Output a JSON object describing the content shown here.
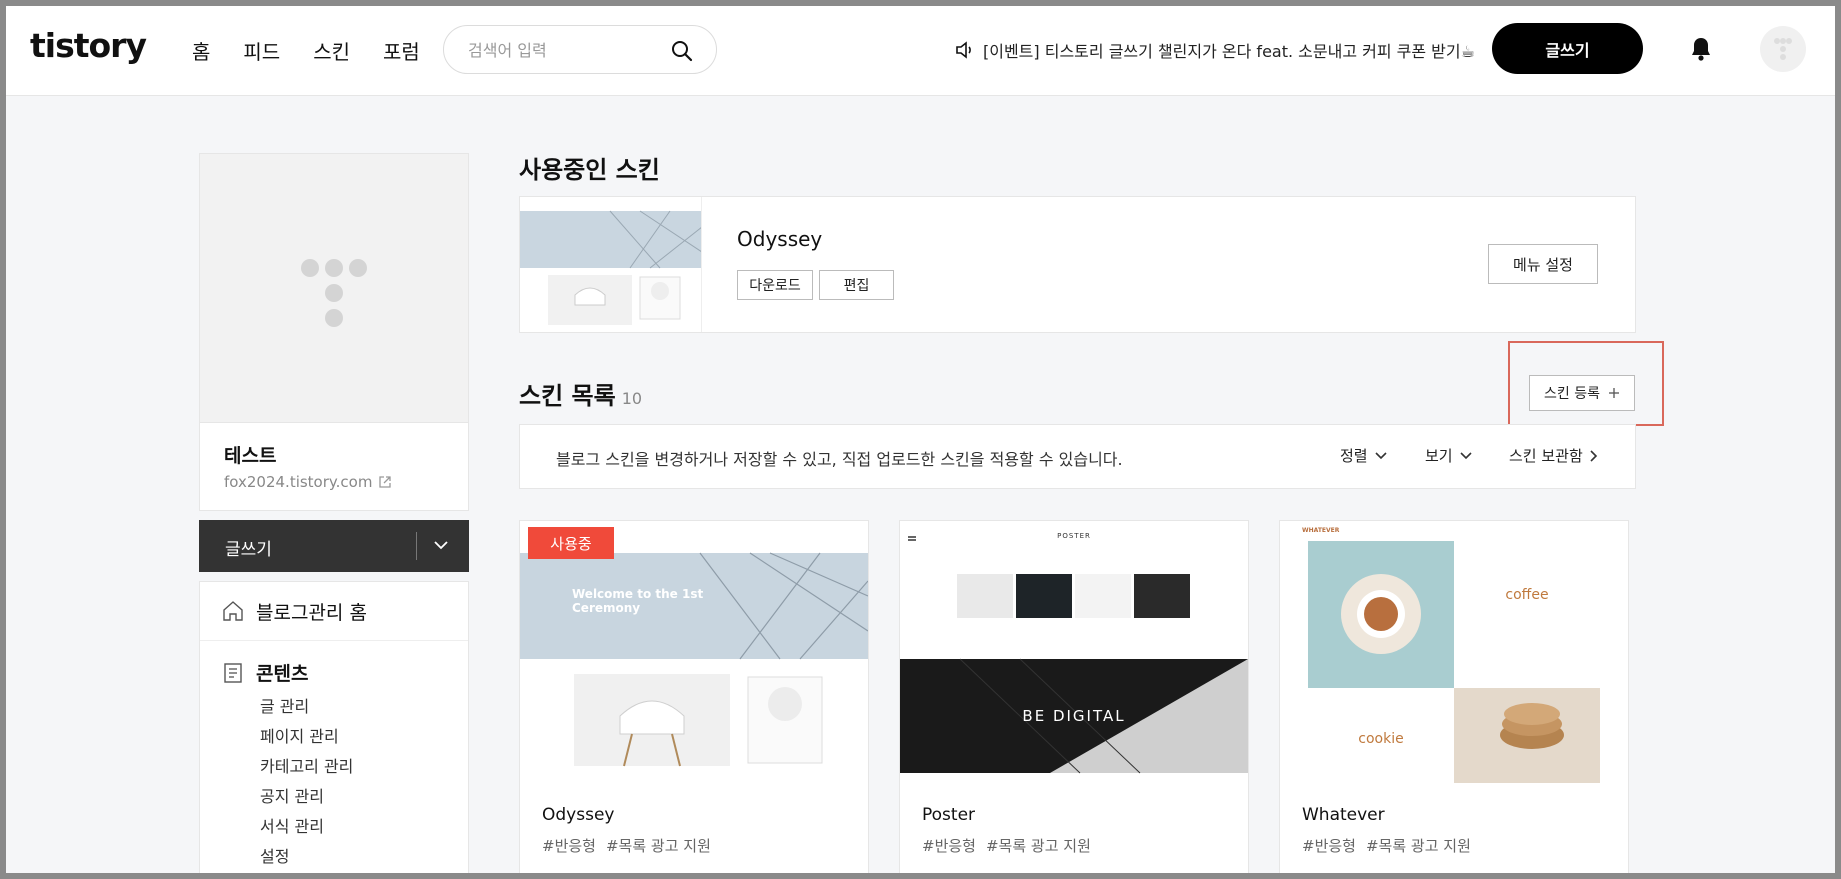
{
  "header": {
    "logo": "tistory",
    "nav": [
      "홈",
      "피드",
      "스킨",
      "포럼"
    ],
    "search_placeholder": "검색어 입력",
    "notice": "[이벤트] 티스토리 글쓰기 챌린지가 온다 feat. 소문내고 커피 쿠폰 받기☕",
    "write_button": "글쓰기"
  },
  "sidebar": {
    "blog_name": "테스트",
    "blog_url": "fox2024.tistory.com",
    "write_button": "글쓰기",
    "home_item": "블로그관리 홈",
    "section_title": "콘텐츠",
    "items": [
      "글 관리",
      "페이지 관리",
      "카테고리 관리",
      "공지 관리",
      "서식 관리",
      "설정"
    ]
  },
  "current_skin": {
    "heading": "사용중인 스킨",
    "name": "Odyssey",
    "download_label": "다운로드",
    "edit_label": "편집",
    "menu_settings_label": "메뉴 설정"
  },
  "skin_list": {
    "heading": "스킨 목록",
    "count": "10",
    "register_label": "스킨 등록",
    "info_text": "블로그 스킨을 변경하거나 저장할 수 있고, 직접 업로드한 스킨을 적용할 수 있습니다.",
    "sort_label": "정렬",
    "view_label": "보기",
    "storage_label": "스킨 보관함",
    "skins": [
      {
        "name": "Odyssey",
        "tags": [
          "#반응형",
          "#목록 광고 지원"
        ],
        "badge": "사용중",
        "preview_text": "Welcome to the 1st Ceremony"
      },
      {
        "name": "Poster",
        "tags": [
          "#반응형",
          "#목록 광고 지원"
        ],
        "preview_text": "BE DIGITAL",
        "preview_header": "POSTER"
      },
      {
        "name": "Whatever",
        "tags": [
          "#반응형",
          "#목록 광고 지원"
        ],
        "preview_word1": "coffee",
        "preview_word2": "cookie",
        "preview_header": "WHATEVER"
      }
    ]
  }
}
